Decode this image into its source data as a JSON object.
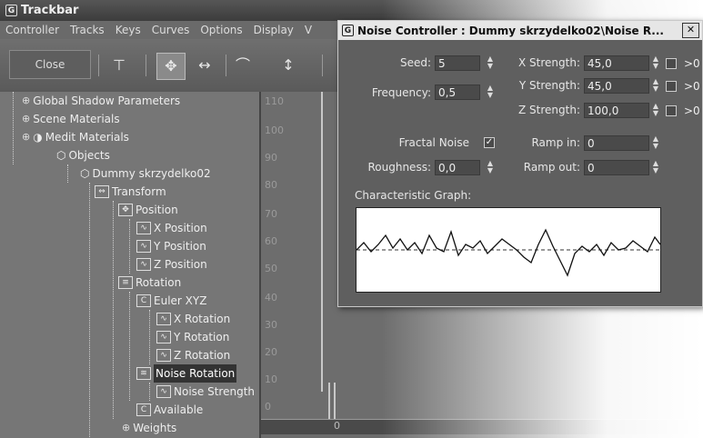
{
  "window": {
    "title": "Trackbar",
    "icon": "app-logo-icon"
  },
  "menu": [
    "Controller",
    "Tracks",
    "Keys",
    "Curves",
    "Options",
    "Display",
    "V"
  ],
  "toolbar": {
    "close_label": "Close"
  },
  "tree": {
    "items": [
      {
        "label": "Global Shadow Parameters",
        "icon": "expand-plus"
      },
      {
        "label": "Scene Materials",
        "icon": "expand-plus"
      },
      {
        "label": "Medit Materials",
        "icon": "material-icon"
      },
      {
        "label": "Objects",
        "icon": "objects-icon"
      },
      {
        "label": "Dummy skrzydelko02",
        "icon": "dummy-icon"
      },
      {
        "label": "Transform",
        "icon": "transform-icon"
      },
      {
        "label": "Position",
        "icon": "position-icon"
      },
      {
        "label": "X Position",
        "icon": "curve-icon"
      },
      {
        "label": "Y Position",
        "icon": "curve-icon"
      },
      {
        "label": "Z Position",
        "icon": "curve-icon"
      },
      {
        "label": "Rotation",
        "icon": "rotation-icon"
      },
      {
        "label": "Euler XYZ",
        "icon": "controller-icon"
      },
      {
        "label": "X Rotation",
        "icon": "curve-icon"
      },
      {
        "label": "Y Rotation",
        "icon": "curve-icon"
      },
      {
        "label": "Z Rotation",
        "icon": "curve-icon"
      },
      {
        "label": "Noise Rotation",
        "icon": "noise-icon"
      },
      {
        "label": "Noise Strength",
        "icon": "curve-icon"
      },
      {
        "label": "Available",
        "icon": "controller-icon"
      },
      {
        "label": "Weights",
        "icon": "expand-plus"
      }
    ]
  },
  "graph": {
    "ticks": [
      "110",
      "100",
      "90",
      "80",
      "70",
      "60",
      "50",
      "40",
      "30",
      "20",
      "10",
      "0"
    ],
    "timebar_zero": "0"
  },
  "dialog": {
    "title": "Noise Controller : Dummy skrzydelko02\\Noise R...",
    "seed_label": "Seed:",
    "seed_value": "5",
    "frequency_label": "Frequency:",
    "frequency_value": "0,5",
    "x_strength_label": "X Strength:",
    "x_strength_value": "45,0",
    "y_strength_label": "Y Strength:",
    "y_strength_value": "45,0",
    "z_strength_label": "Z Strength:",
    "z_strength_value": "100,0",
    "gt0": ">0",
    "fractal_label": "Fractal Noise",
    "fractal_checked": true,
    "roughness_label": "Roughness:",
    "roughness_value": "0,0",
    "ramp_in_label": "Ramp in:",
    "ramp_in_value": "0",
    "ramp_out_label": "Ramp out:",
    "ramp_out_value": "0",
    "graph_label": "Characteristic Graph:"
  }
}
